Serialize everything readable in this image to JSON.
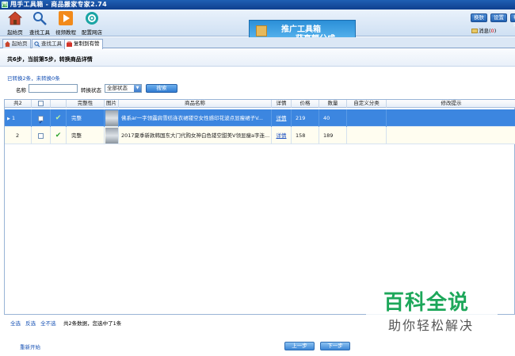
{
  "window": {
    "title": "甩手工具箱 - 商品搬家专家2.74",
    "app_icon_text": "甩"
  },
  "toolbar": {
    "buttons": [
      {
        "label": "起始页",
        "icon": "home-icon"
      },
      {
        "label": "查找工具",
        "icon": "magnifier-icon"
      },
      {
        "label": "视频教程",
        "icon": "play-icon"
      },
      {
        "label": "配置网店",
        "icon": "gear-icon"
      }
    ],
    "banner_line1": "推广工具箱",
    "banner_line2": "获高额分成",
    "right_buttons": [
      "换肤",
      "设置",
      "帮助"
    ],
    "message_label": "消息(",
    "message_count": "0",
    "message_close": ")"
  },
  "tabs": [
    {
      "label": "起始页",
      "icon": "home-icon"
    },
    {
      "label": "查找工具",
      "icon": "search-icon"
    },
    {
      "label": "复制到有赞",
      "icon": "bag-icon"
    }
  ],
  "step_text": "共6步，当前第5步，转换商品详情",
  "filter": {
    "converted_link": "已转换2条，未转换0条",
    "name_label": "名称",
    "name_value": "",
    "status_label": "转换状态",
    "status_value": "全部状态",
    "search_button": "搜索"
  },
  "grid": {
    "columns": [
      "共2",
      "",
      "完整性",
      "图片",
      "商品名称",
      "详情",
      "价格",
      "数量",
      "自定义分类",
      "修改提示"
    ],
    "rows": [
      {
        "index": "1",
        "checked": true,
        "completeness": "完整",
        "name": "佛系ar一字领露肩雪纺连衣裙镂空女性感印花波点显瘦裙子V...",
        "detail": "详情",
        "price": "219",
        "quantity": "40",
        "category": "",
        "hint": "",
        "selected": true
      },
      {
        "index": "2",
        "checked": false,
        "completeness": "完整",
        "name": "2017夏季新款韩国东大门代购女神白色镂空甜美V领显瘦a字连...",
        "detail": "详情",
        "price": "158",
        "quantity": "189",
        "category": "",
        "hint": "",
        "selected": false
      }
    ]
  },
  "footer": {
    "select_all": "全选",
    "invert": "反选",
    "select_none": "全不选",
    "status": "共2条数据，您选中了1条",
    "restart": "重新开始",
    "prev": "上一步",
    "next": "下一步"
  },
  "watermark": {
    "line1": "百科全说",
    "line2": "助你轻松解决"
  },
  "colors": {
    "accent": "#3c86e0",
    "title_bar": "#1f5fb4",
    "link": "#1752b5",
    "watermark": "#1da75a"
  }
}
